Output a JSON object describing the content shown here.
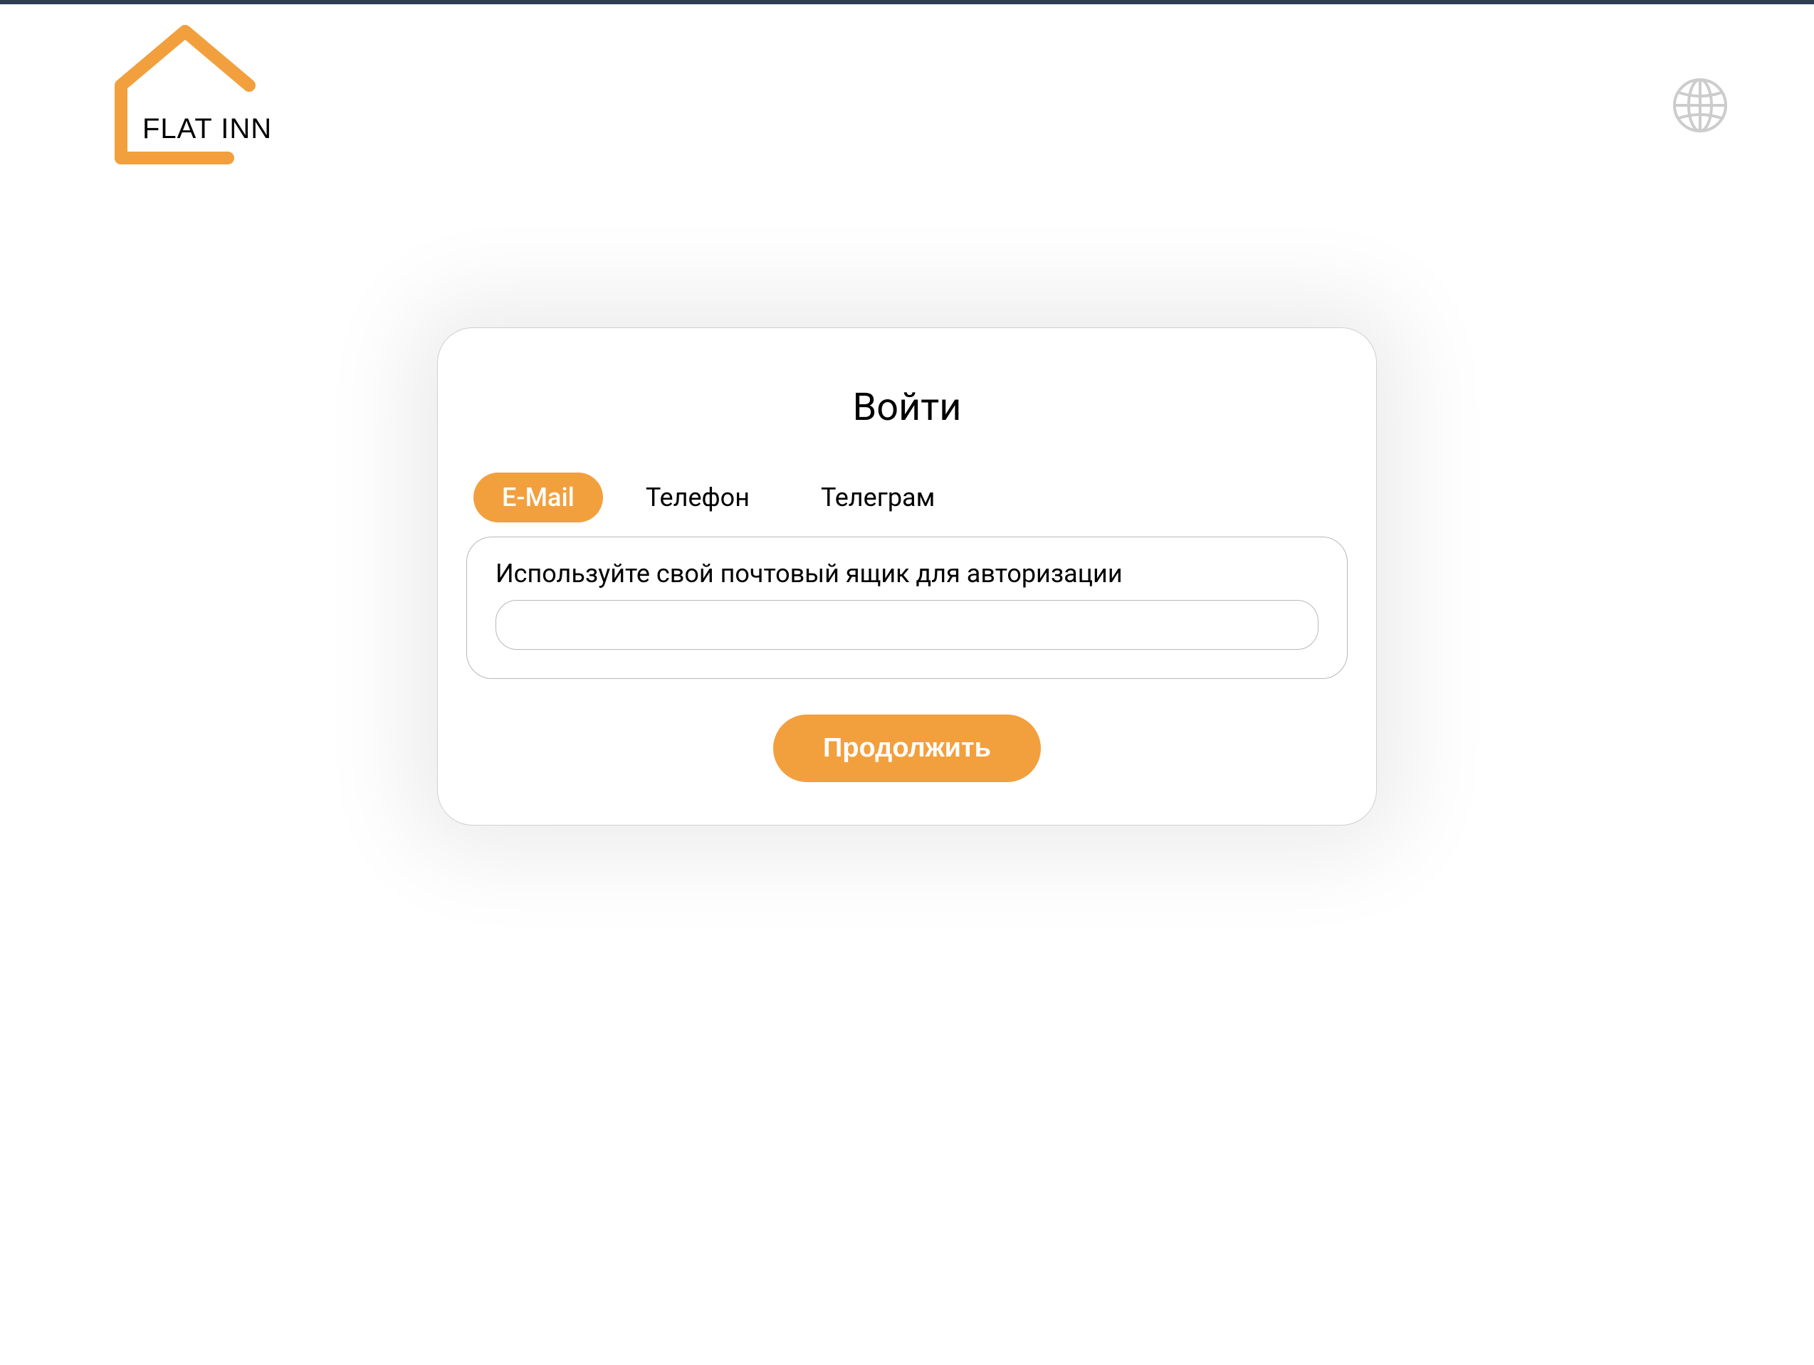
{
  "header": {
    "brand_name": "FLAT INN"
  },
  "login": {
    "title": "Войти",
    "tabs": {
      "email": "E-Mail",
      "phone": "Телефон",
      "telegram": "Телеграм"
    },
    "input_label": "Используйте свой почтовый ящик для авторизации",
    "email_value": "",
    "continue_label": "Продолжить"
  },
  "colors": {
    "accent": "#f2a03d",
    "top_bar": "#2c3e50"
  }
}
